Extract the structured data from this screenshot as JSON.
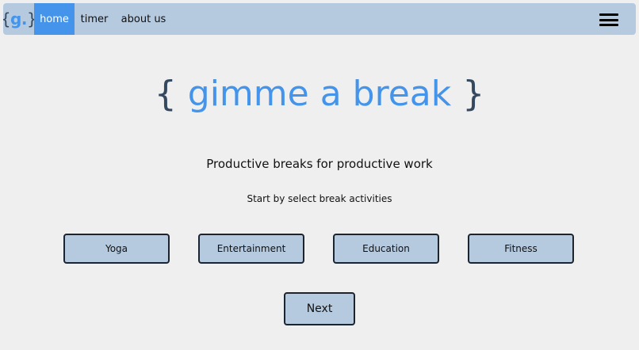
{
  "nav": {
    "logo": {
      "open_brace": "{",
      "letter": "g.",
      "close_brace": "}"
    },
    "links": {
      "home": "home",
      "timer": "timer",
      "about": "about us"
    },
    "active_link": "home",
    "menu_icon": "hamburger-menu-icon"
  },
  "hero": {
    "open_brace": "{",
    "title": "gimme a break",
    "close_brace": "}",
    "tagline": "Productive breaks for productive work",
    "instruction": "Start by select break activities"
  },
  "activities": {
    "yoga": "Yoga",
    "entertainment": "Entertainment",
    "education": "Education",
    "fitness": "Fitness"
  },
  "actions": {
    "next": "Next"
  },
  "colors": {
    "accent_blue": "#4394ea",
    "nav_background": "#b5c9df",
    "button_background": "#b5c9df",
    "page_background": "#efefef",
    "brace_color": "#34495f"
  }
}
